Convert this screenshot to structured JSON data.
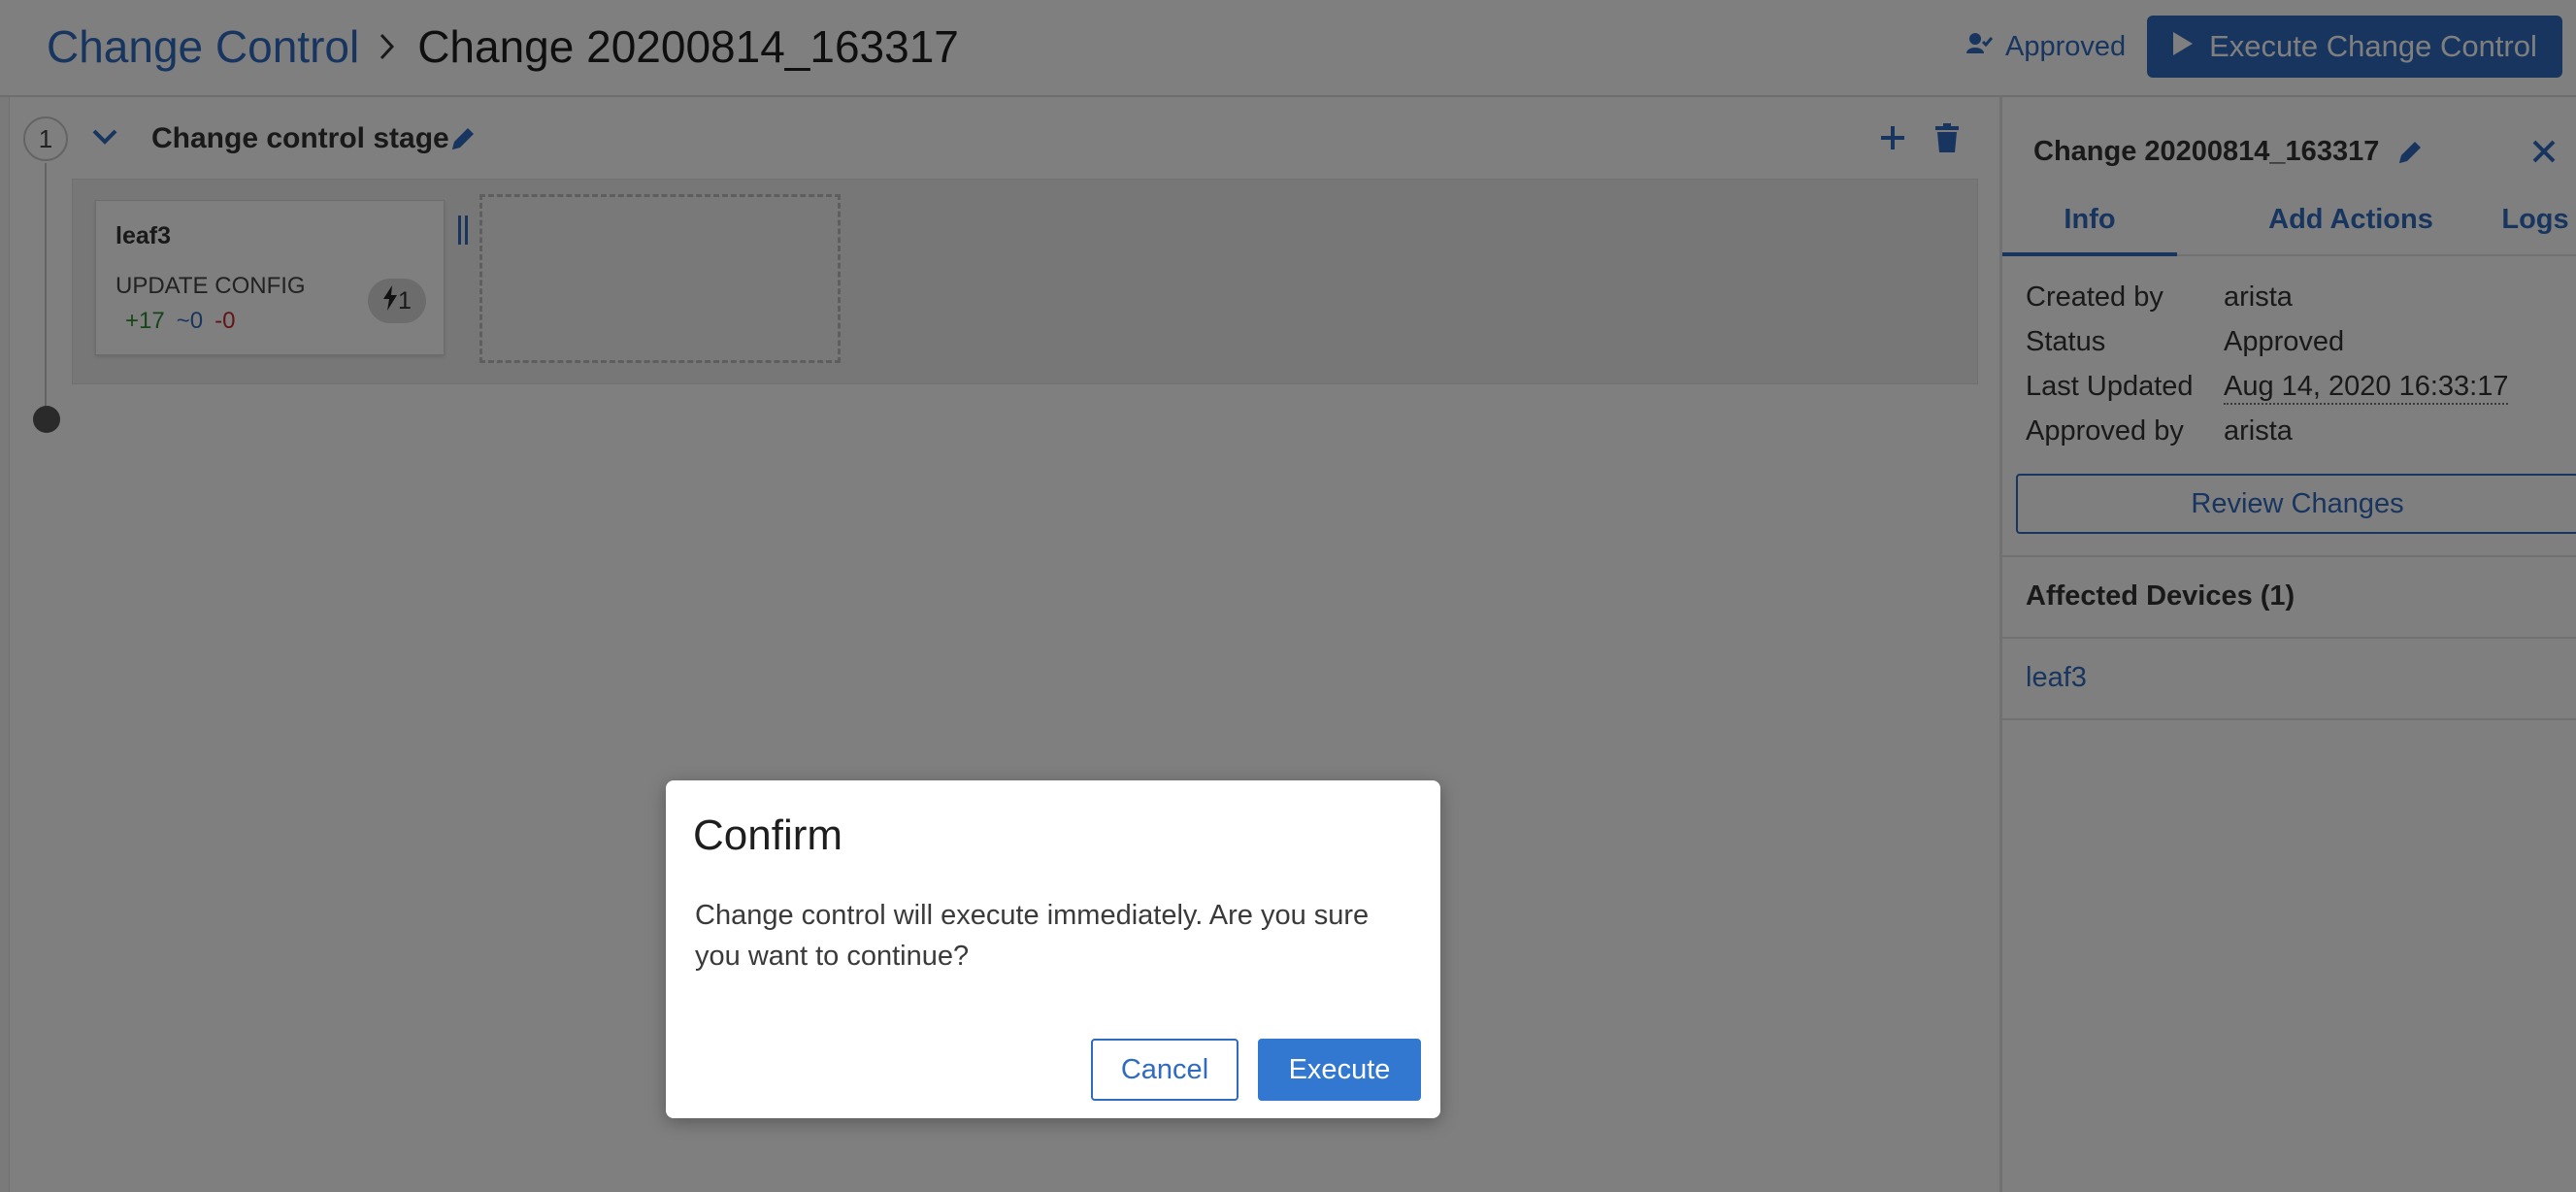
{
  "header": {
    "breadcrumb_root": "Change Control",
    "breadcrumb_current": "Change 20200814_163317",
    "approved_label": "Approved",
    "execute_button_label": "Execute Change Control"
  },
  "stage": {
    "number": "1",
    "title": "Change control stage",
    "card": {
      "device": "leaf3",
      "action": "UPDATE CONFIG",
      "added": "+17",
      "modified": "~0",
      "deleted": "-0",
      "badge_count": "1"
    }
  },
  "panel": {
    "title": "Change 20200814_163317",
    "tabs": {
      "info": "Info",
      "actions": "Add Actions",
      "logs": "Logs"
    },
    "info": [
      {
        "key": "Created by",
        "value": "arista"
      },
      {
        "key": "Status",
        "value": "Approved"
      },
      {
        "key": "Last Updated",
        "value": "Aug 14, 2020 16:33:17"
      },
      {
        "key": "Approved by",
        "value": "arista"
      }
    ],
    "review_button": "Review Changes",
    "affected_title": "Affected Devices (1)",
    "affected_devices": [
      "leaf3"
    ]
  },
  "modal": {
    "title": "Confirm",
    "message": "Change control will execute immediately. Are you sure you want to continue?",
    "cancel_label": "Cancel",
    "execute_label": "Execute"
  },
  "colors": {
    "accent": "#2f6bbf",
    "added": "#2e8a34",
    "deleted": "#c62828",
    "overlay": "rgba(0,0,0,0.5)"
  }
}
